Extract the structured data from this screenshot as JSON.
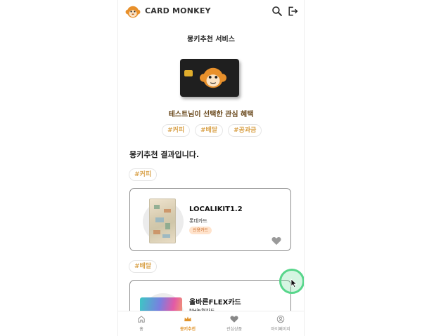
{
  "header": {
    "brand": "CARD MONKEY"
  },
  "service": {
    "title": "몽키추천 서비스"
  },
  "interest": {
    "title": "테스트님이 선택한 관심 혜택",
    "tags": [
      "#커피",
      "#배달",
      "#공과금"
    ]
  },
  "results": {
    "title": "몽키추천 결과입니다.",
    "groups": [
      {
        "category": "#커피",
        "card": {
          "name": "LOCALIKIT1.2",
          "company": "롯데카드",
          "badge": "신용카드"
        }
      },
      {
        "category": "#배달",
        "card": {
          "name": "올바른FLEX카드",
          "company": "NH농협카드"
        }
      }
    ]
  },
  "nav": {
    "items": [
      {
        "label": "홈",
        "icon": "home-icon"
      },
      {
        "label": "몽키추천",
        "icon": "crown-icon"
      },
      {
        "label": "관심상품",
        "icon": "heart-icon"
      },
      {
        "label": "마이페이지",
        "icon": "user-icon"
      }
    ],
    "active": "몽키추천"
  },
  "colors": {
    "accent": "#e0932a",
    "tag_text": "#d9a24a",
    "badge_bg": "#ffe3cc",
    "card_black": "#1f1f1f",
    "highlight": "#58d68b"
  }
}
